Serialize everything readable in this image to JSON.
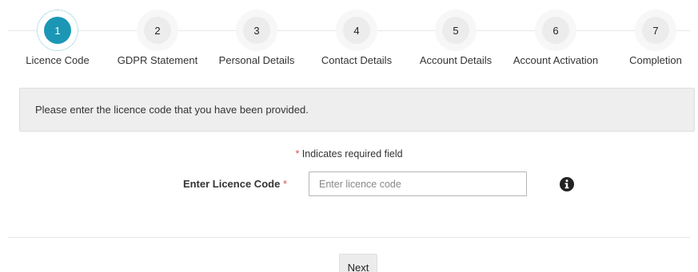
{
  "stepper": {
    "active_step": 1,
    "steps": [
      {
        "number": "1",
        "label": "Licence Code"
      },
      {
        "number": "2",
        "label": "GDPR Statement"
      },
      {
        "number": "3",
        "label": "Personal Details"
      },
      {
        "number": "4",
        "label": "Contact Details"
      },
      {
        "number": "5",
        "label": "Account Details"
      },
      {
        "number": "6",
        "label": "Account Activation"
      },
      {
        "number": "7",
        "label": "Completion"
      }
    ]
  },
  "info_panel": {
    "text": "Please enter the licence code that you have been provided."
  },
  "form": {
    "required_star": "*",
    "required_note": " Indicates required field",
    "licence_label": "Enter Licence Code",
    "licence_placeholder": "Enter licence code",
    "licence_value": ""
  },
  "actions": {
    "next_label": "Next"
  },
  "colors": {
    "accent": "#1b97b5",
    "required": "#d9534f",
    "panel_bg": "#eeeeee"
  },
  "icons": {
    "help": "info-circle-icon"
  }
}
